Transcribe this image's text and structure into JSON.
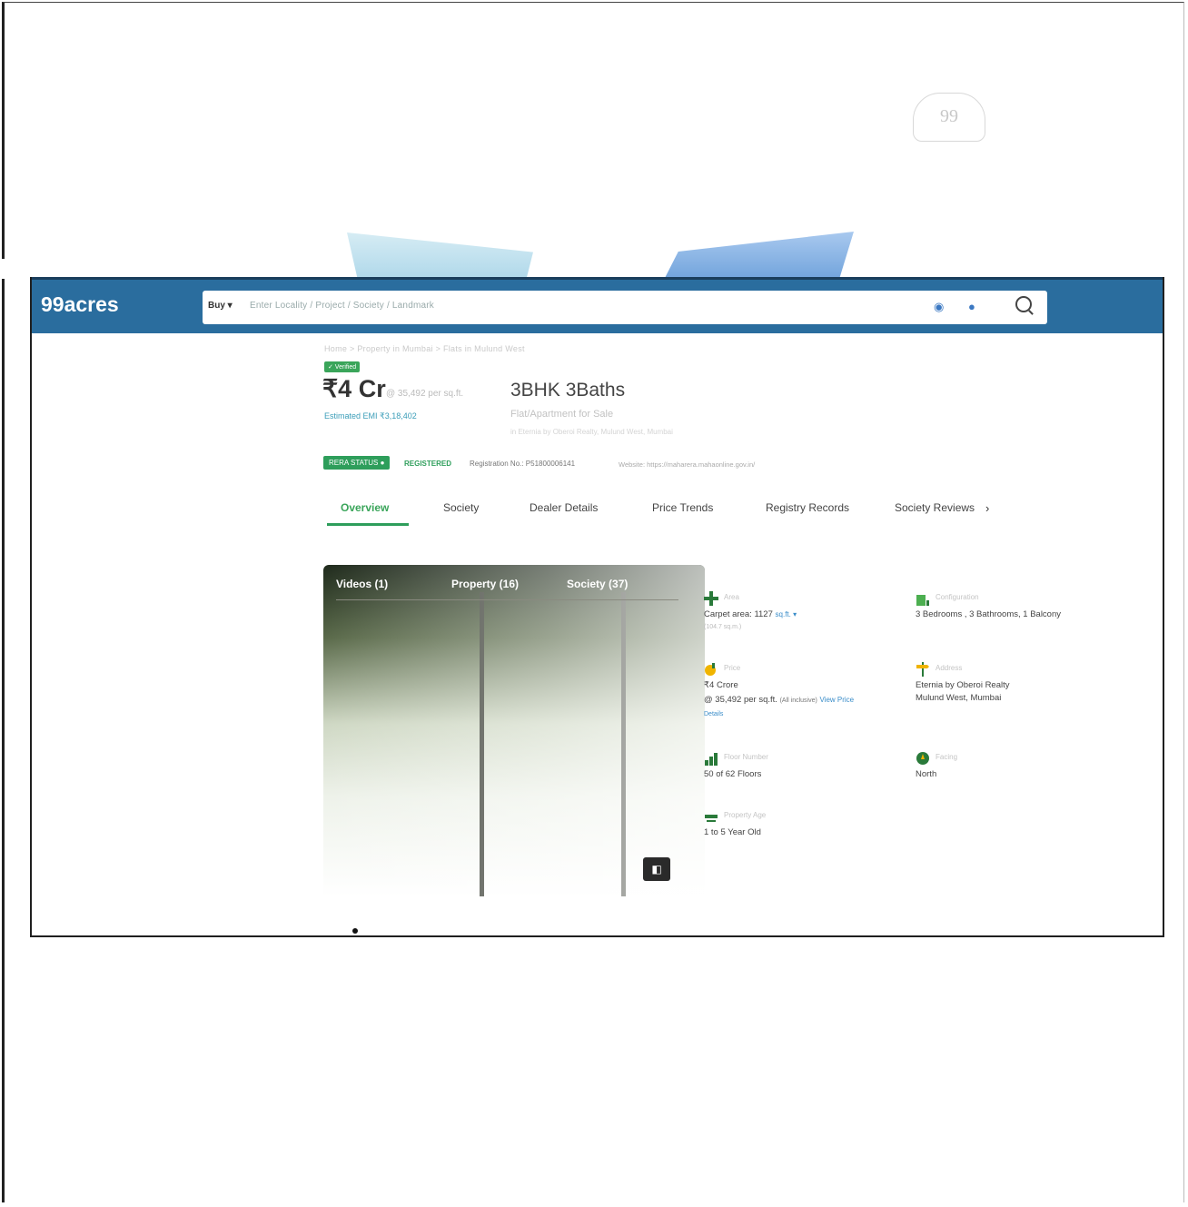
{
  "scan": {
    "logo_text": "99"
  },
  "header": {
    "brand": "99acres",
    "search": {
      "dropdown": "Buy ▾",
      "placeholder": "Enter Locality / Project / Society / Landmark"
    }
  },
  "listing": {
    "breadcrumb": "Home > Property in Mumbai > Flats in Mulund West",
    "verified": "✓ Verified",
    "price": "₹4 Cr",
    "price_per_sqft": "@ 35,492 per sq.ft.",
    "emi": "Estimated EMI ₹3,18,402",
    "title": "3BHK 3Baths",
    "subtitle": "Flat/Apartment for Sale",
    "location_line": "in Eternia by Oberoi Realty, Mulund West, Mumbai",
    "rera": {
      "badge": "RERA STATUS ●",
      "status": "REGISTERED",
      "registration": "Registration No.: P51800006141",
      "website": "Website: https://maharera.mahaonline.gov.in/"
    }
  },
  "tabs": [
    "Overview",
    "Society",
    "Dealer Details",
    "Price Trends",
    "Registry Records",
    "Society Reviews"
  ],
  "tab_more": "›",
  "media": {
    "tabs": [
      "Videos (1)",
      "Property (16)",
      "Society (37)"
    ]
  },
  "specs": {
    "area": {
      "label": "Area",
      "value": "Carpet area: 1127",
      "unit": "sq.ft. ▾",
      "meta": "(104.7 sq.m.)"
    },
    "configuration": {
      "label": "Configuration",
      "value": "3 Bedrooms , 3 Bathrooms, 1 Balcony"
    },
    "price": {
      "label": "Price",
      "value": "₹4 Crore",
      "value2": "@ 35,492 per sq.ft.",
      "inclusive": "(All inclusive)",
      "link": "View Price",
      "link2": "Details"
    },
    "address": {
      "label": "Address",
      "value": "Eternia by Oberoi Realty",
      "value2": "Mulund West, Mumbai"
    },
    "floor": {
      "label": "Floor Number",
      "value": "50  of 62 Floors"
    },
    "facing": {
      "label": "Facing",
      "value": "North"
    },
    "age": {
      "label": "Property Age",
      "value": "1 to 5 Year Old"
    }
  },
  "colors": {
    "nav": "#2a6d9e",
    "accent": "#2e9e5b",
    "link": "#3a8dc9"
  }
}
